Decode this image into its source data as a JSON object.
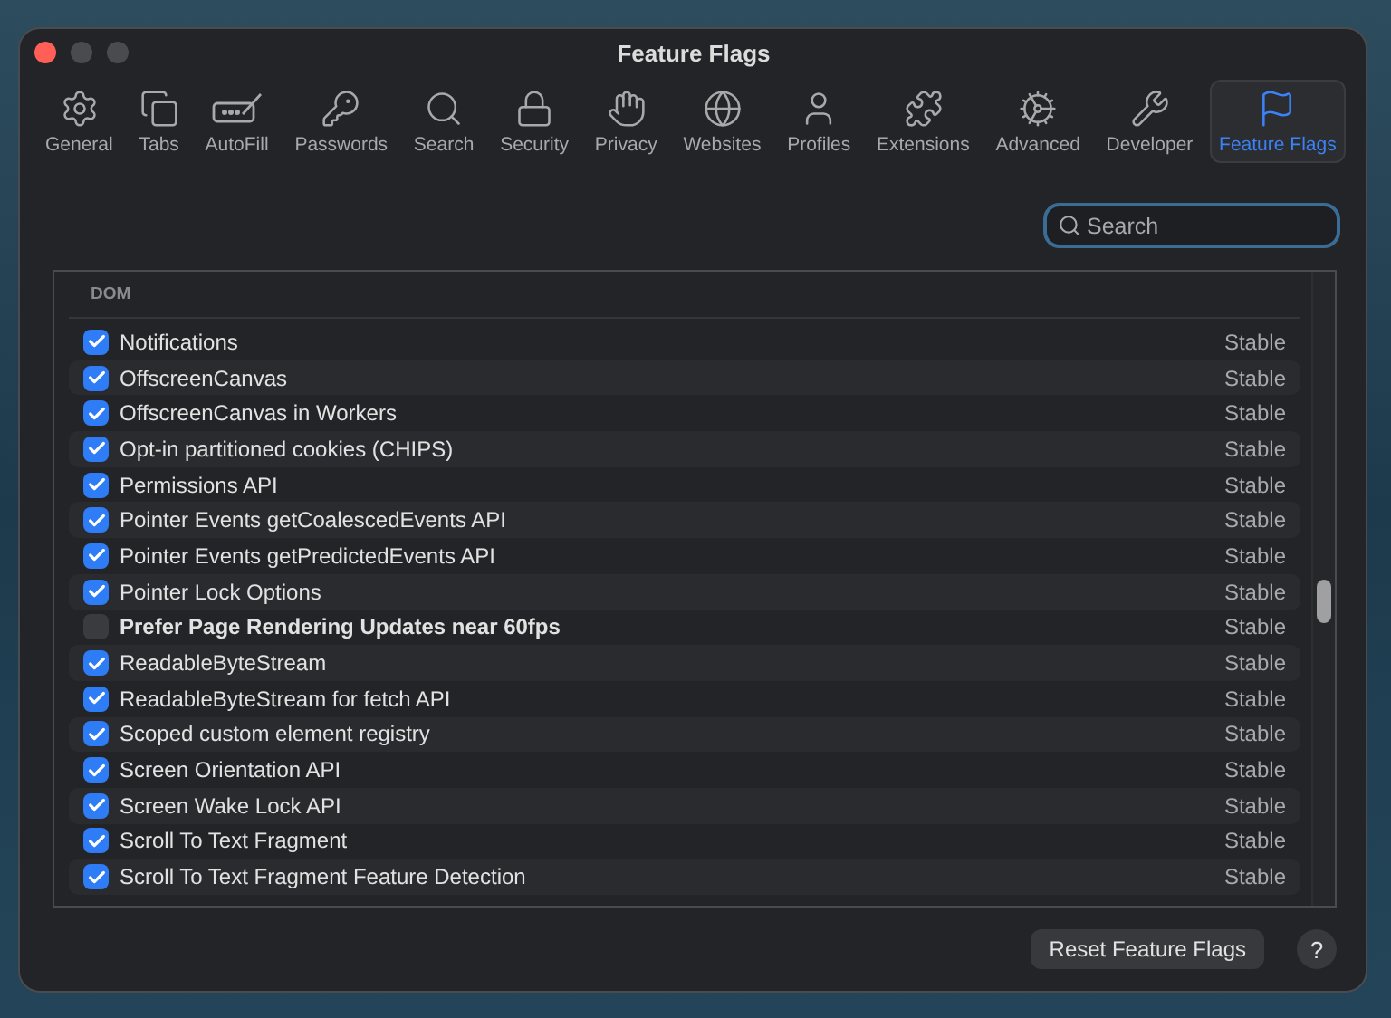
{
  "window": {
    "title": "Feature Flags"
  },
  "toolbar": [
    {
      "label": "General",
      "selected": false
    },
    {
      "label": "Tabs",
      "selected": false
    },
    {
      "label": "AutoFill",
      "selected": false
    },
    {
      "label": "Passwords",
      "selected": false
    },
    {
      "label": "Search",
      "selected": false
    },
    {
      "label": "Security",
      "selected": false
    },
    {
      "label": "Privacy",
      "selected": false
    },
    {
      "label": "Websites",
      "selected": false
    },
    {
      "label": "Profiles",
      "selected": false
    },
    {
      "label": "Extensions",
      "selected": false
    },
    {
      "label": "Advanced",
      "selected": false
    },
    {
      "label": "Developer",
      "selected": false
    },
    {
      "label": "Feature Flags",
      "selected": true
    }
  ],
  "search": {
    "placeholder": "Search"
  },
  "list": {
    "section": "DOM",
    "rows": [
      {
        "name": "Notifications",
        "status": "Stable",
        "checked": true,
        "modified": false
      },
      {
        "name": "OffscreenCanvas",
        "status": "Stable",
        "checked": true,
        "modified": false
      },
      {
        "name": "OffscreenCanvas in Workers",
        "status": "Stable",
        "checked": true,
        "modified": false
      },
      {
        "name": "Opt-in partitioned cookies (CHIPS)",
        "status": "Stable",
        "checked": true,
        "modified": false
      },
      {
        "name": "Permissions API",
        "status": "Stable",
        "checked": true,
        "modified": false
      },
      {
        "name": "Pointer Events getCoalescedEvents API",
        "status": "Stable",
        "checked": true,
        "modified": false
      },
      {
        "name": "Pointer Events getPredictedEvents API",
        "status": "Stable",
        "checked": true,
        "modified": false
      },
      {
        "name": "Pointer Lock Options",
        "status": "Stable",
        "checked": true,
        "modified": false
      },
      {
        "name": "Prefer Page Rendering Updates near 60fps",
        "status": "Stable",
        "checked": false,
        "modified": true
      },
      {
        "name": "ReadableByteStream",
        "status": "Stable",
        "checked": true,
        "modified": false
      },
      {
        "name": "ReadableByteStream for fetch API",
        "status": "Stable",
        "checked": true,
        "modified": false
      },
      {
        "name": "Scoped custom element registry",
        "status": "Stable",
        "checked": true,
        "modified": false
      },
      {
        "name": "Screen Orientation API",
        "status": "Stable",
        "checked": true,
        "modified": false
      },
      {
        "name": "Screen Wake Lock API",
        "status": "Stable",
        "checked": true,
        "modified": false
      },
      {
        "name": "Scroll To Text Fragment",
        "status": "Stable",
        "checked": true,
        "modified": false
      },
      {
        "name": "Scroll To Text Fragment Feature Detection",
        "status": "Stable",
        "checked": true,
        "modified": false
      }
    ]
  },
  "buttons": {
    "reset": "Reset Feature Flags",
    "help": "?"
  }
}
